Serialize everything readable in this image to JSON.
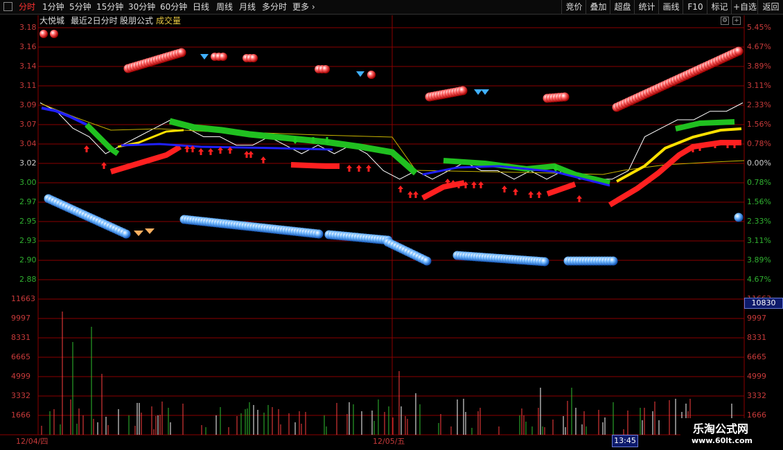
{
  "toolbar": {
    "left_items": [
      "分时",
      "1分钟",
      "5分钟",
      "15分钟",
      "30分钟",
      "60分钟",
      "日线",
      "周线",
      "月线",
      "多分时",
      "更多 ›"
    ],
    "right_items": [
      "竞价",
      "叠加",
      "超盘",
      "统计",
      "画线",
      "F10",
      "标记",
      "+自选",
      "返回"
    ]
  },
  "info": {
    "stock_name": "大悦城",
    "period": "最近2日分时",
    "formula": "股朋公式",
    "indicator": "成交量",
    "price_color": "#c83a3a",
    "pct_color": "#c83a3a",
    "volume_color": "#c83a3a"
  },
  "price_axis": {
    "ticks": [
      "3.18",
      "3.16",
      "3.14",
      "3.11",
      "3.09",
      "3.07",
      "3.04",
      "3.02",
      "3.00",
      "2.97",
      "2.95",
      "2.93",
      "2.90",
      "2.88"
    ],
    "up_ticks": [
      "3.18",
      "3.16",
      "3.14",
      "3.11",
      "3.09",
      "3.07",
      "3.04"
    ],
    "base": "3.02"
  },
  "pct_axis": {
    "ticks": [
      "5.45%",
      "4.67%",
      "3.89%",
      "3.11%",
      "2.33%",
      "1.56%",
      "0.78%",
      "0.00%",
      "0.78%",
      "1.56%",
      "2.33%",
      "3.11%",
      "3.89%",
      "4.67%"
    ]
  },
  "volume_axis": {
    "ticks": [
      "11663",
      "9997",
      "8331",
      "6665",
      "4999",
      "3332",
      "1666"
    ],
    "current": "10830"
  },
  "dates": {
    "day1": "12/04/四",
    "day2": "12/05/五",
    "cursor_time": "13:45"
  },
  "watermark": {
    "cn": "乐淘公式网",
    "url": "www.60lt.com"
  },
  "colors": {
    "grid": "#8b0000",
    "up": "#ff2020",
    "down": "#20c020",
    "ma_yellow": "#ffe000",
    "ma_blue": "#2020ff",
    "price_line": "#ffffff"
  },
  "chart_data": {
    "type": "line",
    "series": [
      {
        "values": [
          3.09,
          3.08,
          3.06,
          3.05,
          3.03,
          3.04,
          3.05,
          3.06,
          3.07,
          3.06,
          3.05,
          3.05,
          3.04,
          3.04,
          3.05,
          3.04,
          3.03,
          3.04,
          3.03,
          3.04,
          3.03,
          3.01,
          3.0,
          3.01,
          3.0,
          3.01,
          3.02,
          3.01,
          3.01,
          3.0,
          3.01,
          3.0,
          3.01,
          3.0,
          3.0,
          3.0,
          3.01,
          3.05,
          3.06,
          3.07,
          3.07,
          3.08,
          3.08,
          3.09
        ]
      }
    ],
    "ylim": [
      2.87,
      3.19
    ]
  }
}
